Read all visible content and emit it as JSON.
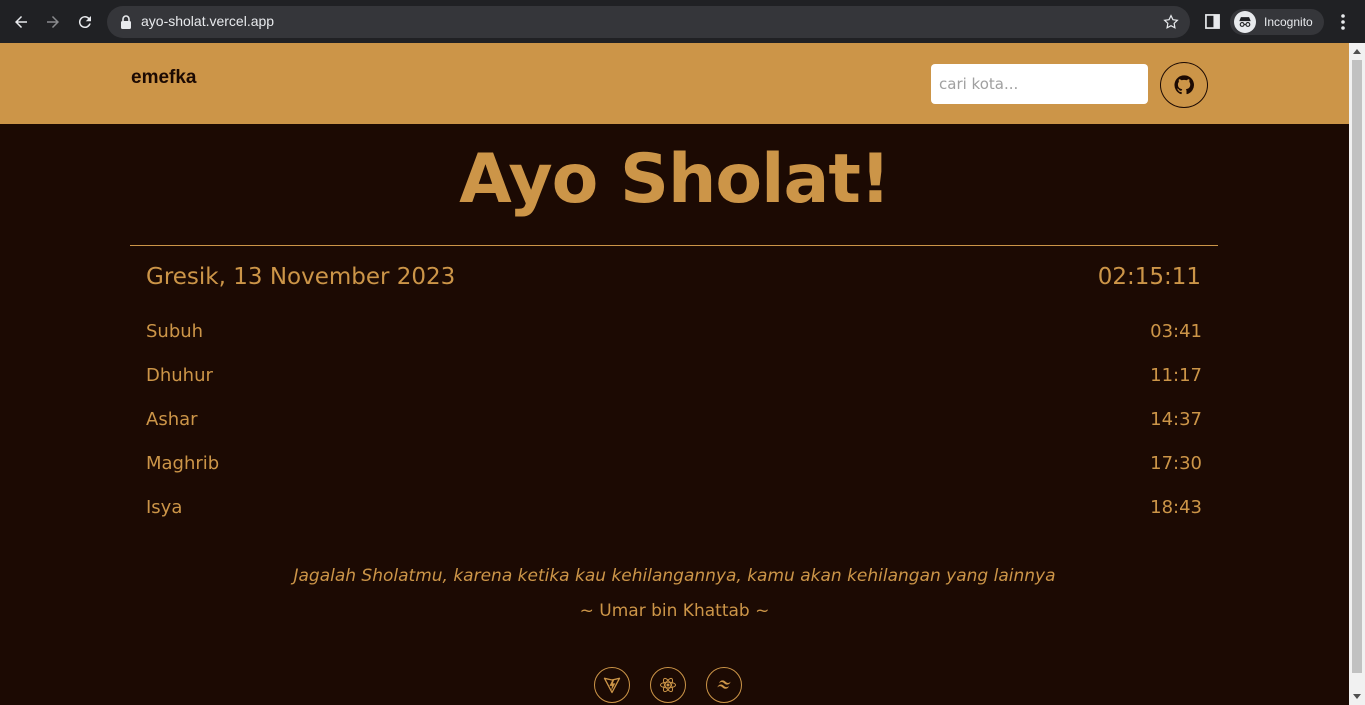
{
  "browser": {
    "url": "ayo-sholat.vercel.app",
    "profile_label": "Incognito",
    "icons": [
      "back-icon",
      "forward-icon",
      "reload-icon",
      "lock-icon",
      "star-icon",
      "side-panel-icon",
      "incognito-icon",
      "menu-icon"
    ]
  },
  "header": {
    "brand": "emefka",
    "search_placeholder": "cari kota...",
    "github_icon": "github-icon"
  },
  "main": {
    "title": "Ayo Sholat!",
    "location_date": "Gresik, 13 November 2023",
    "clock": "02:15:11",
    "prayers": [
      {
        "name": "Subuh",
        "time": "03:41"
      },
      {
        "name": "Dhuhur",
        "time": "11:17"
      },
      {
        "name": "Ashar",
        "time": "14:37"
      },
      {
        "name": "Maghrib",
        "time": "17:30"
      },
      {
        "name": "Isya",
        "time": "18:43"
      }
    ],
    "quote": "Jagalah Sholatmu, karena ketika kau kehilangannya, kamu akan kehilangan yang lainnya",
    "quote_author": "~ Umar bin Khattab ~"
  },
  "footer": {
    "tech_icons": [
      "vite-icon",
      "react-icon",
      "tailwind-icon"
    ]
  },
  "colors": {
    "accent": "#cc9548",
    "background": "#1c0a03",
    "chrome": "#202124"
  }
}
